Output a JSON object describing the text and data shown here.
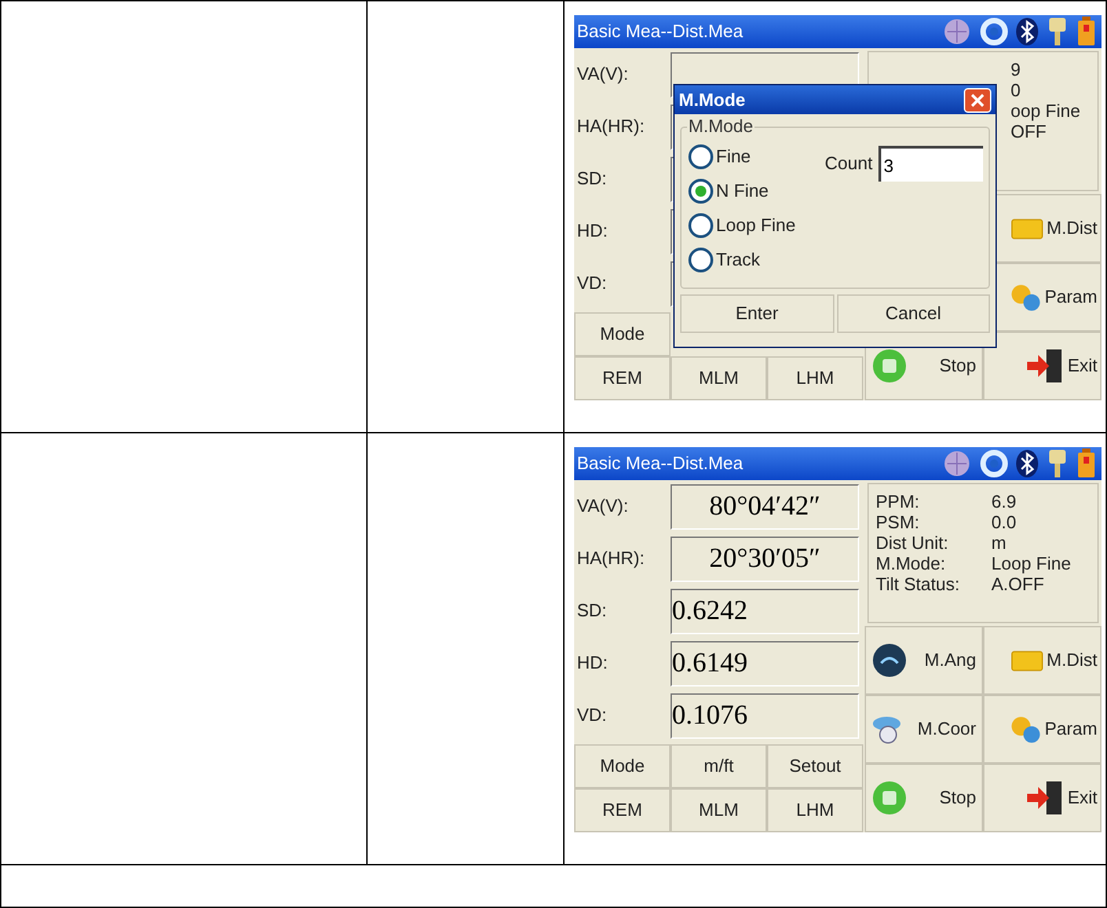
{
  "screens": [
    {
      "title": "Basic Mea--Dist.Mea",
      "fields": [
        {
          "label": "VA(V):",
          "kind": "angle"
        },
        {
          "label": "HA(HR):",
          "kind": "angle"
        },
        {
          "label": "SD:",
          "kind": "distance"
        },
        {
          "label": "HD:",
          "kind": "distance"
        },
        {
          "label": "VD:",
          "kind": "distance"
        }
      ],
      "info": [
        {
          "value": "9"
        },
        {
          "value": "0"
        },
        {
          "value": "oop Fine"
        },
        {
          "value": "OFF"
        }
      ],
      "side_columns": [
        [
          "Stop"
        ],
        [
          "M.Dist",
          "Param",
          "Exit"
        ]
      ],
      "bottom_rows": [
        [
          "Mode"
        ],
        [
          "REM",
          "MLM",
          "LHM"
        ]
      ],
      "dialog": {
        "title": "M.Mode",
        "group_label": "M.Mode",
        "options": [
          {
            "label": "Fine",
            "selected": false
          },
          {
            "label": "N Fine",
            "selected": true
          },
          {
            "label": "Loop Fine",
            "selected": false
          },
          {
            "label": "Track",
            "selected": false
          }
        ],
        "count_label": "Count",
        "count_value": "3",
        "buttons": [
          "Enter",
          "Cancel"
        ]
      }
    },
    {
      "title": "Basic Mea--Dist.Mea",
      "fields": [
        {
          "label": "VA(V):",
          "kind": "angle",
          "value": "80°04′42″"
        },
        {
          "label": "HA(HR):",
          "kind": "angle",
          "value": "20°30′05″"
        },
        {
          "label": "SD:",
          "kind": "distance",
          "value": "0.6242"
        },
        {
          "label": "HD:",
          "kind": "distance",
          "value": "0.6149"
        },
        {
          "label": "VD:",
          "kind": "distance",
          "value": "0.1076"
        }
      ],
      "info": [
        {
          "label": "PPM:",
          "value": "6.9"
        },
        {
          "label": "PSM:",
          "value": "0.0"
        },
        {
          "label": "Dist Unit:",
          "value": "m"
        },
        {
          "label": "M.Mode:",
          "value": "Loop Fine"
        },
        {
          "label": "Tilt Status:",
          "value": "A.OFF"
        }
      ],
      "side_columns": [
        [
          "M.Ang",
          "M.Coor",
          "Stop"
        ],
        [
          "M.Dist",
          "Param",
          "Exit"
        ]
      ],
      "bottom_rows": [
        [
          "Mode",
          "m/ft",
          "Setout"
        ],
        [
          "REM",
          "MLM",
          "LHM"
        ]
      ]
    }
  ]
}
